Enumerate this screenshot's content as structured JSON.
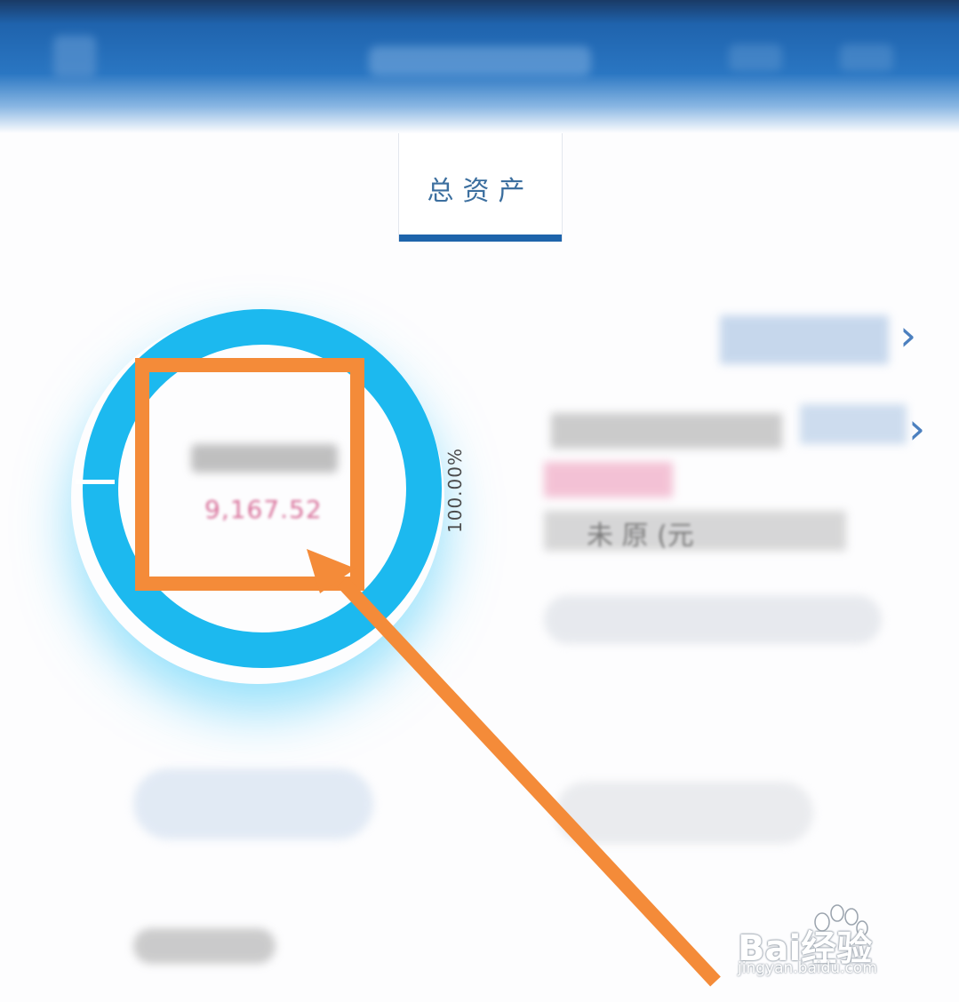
{
  "tab": {
    "label": "总资产"
  },
  "donut": {
    "percent_label": "100.00%",
    "center_value": "9,167.52",
    "ring_color": "#1cb9ef",
    "share": 1.0
  },
  "right_panel": {
    "row4_text": "未  原  (元"
  },
  "annotation": {
    "color": "#f48b39"
  },
  "watermark": {
    "brand": "Bai经验",
    "sub": "jingyan.baidu.com"
  }
}
